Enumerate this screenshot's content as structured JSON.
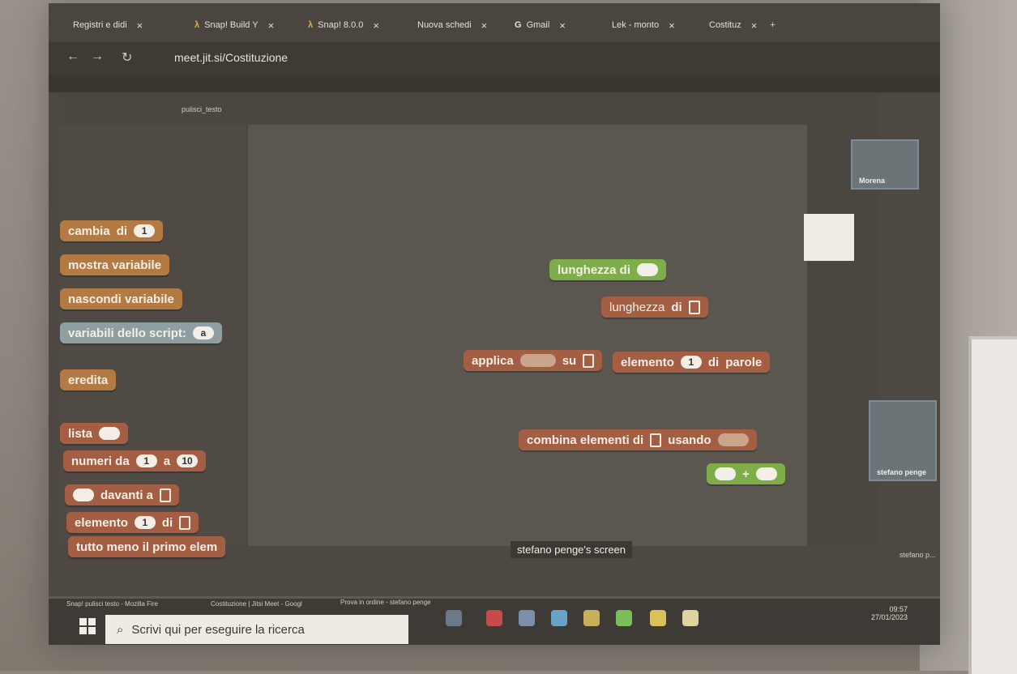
{
  "browser": {
    "tabs": [
      "Registri e didi",
      "Snap! Build Y",
      "Snap! 8.0.0",
      "Nuova schedi",
      "Gmail",
      "Lek - monto",
      "Costituz"
    ],
    "url": "meet.jit.si/Costituzione"
  },
  "jitsi": {
    "logo": "jitsi"
  },
  "snap": {
    "project_title": "pulisci_testo",
    "palette_blocks": [
      {
        "label": "cambia",
        "slot": "1",
        "kw": "di"
      },
      {
        "label": "mostra variabile"
      },
      {
        "label": "nascondi variabile"
      },
      {
        "label": "variabili dello script:",
        "slot": "a"
      },
      {
        "label": "eredita"
      },
      {
        "label": "lista"
      },
      {
        "label": "numeri da",
        "slot1": "1",
        "kw": "a",
        "slot2": "10"
      },
      {
        "label": "davanti a"
      },
      {
        "label": "elemento",
        "slot": "1",
        "kw": "di"
      },
      {
        "label": "tutto meno il primo elem"
      },
      {
        "label": "lunghezza",
        "kw": "di"
      }
    ],
    "script_blocks": {
      "lunghezza_di": "lunghezza di",
      "lunghezza_dropdown": "lunghezza",
      "di": "di",
      "applica": "applica",
      "su": "su",
      "elemento": "elemento",
      "elemento_slot": "1",
      "di_parole": "di",
      "parole": "parole",
      "combina": "combina elementi di",
      "usando": "usando",
      "plus": "+"
    }
  },
  "participants": {
    "top_name": "Morena",
    "side_name": "stefano penge",
    "side_name_short": "stefano p..."
  },
  "screen_label": "stefano penge's screen",
  "taskbar": {
    "search_placeholder": "Scrivi qui per eseguire la ricerca",
    "window_1": "Snap! pulisci testo - Mozilla Fire",
    "window_2": "Costituzione | Jitsi Meet - Googl",
    "window_3": "Prova in ordine - stefano penge",
    "time": "09:57",
    "date": "27/01/2023"
  }
}
